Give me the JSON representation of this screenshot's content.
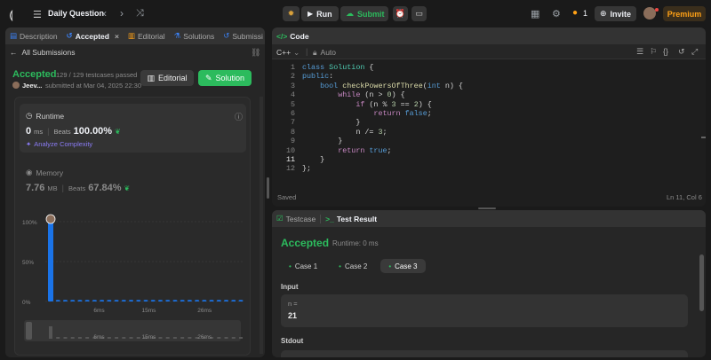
{
  "topbar": {
    "title": "Daily Question",
    "run": "Run",
    "submit": "Submit",
    "invite": "Invite",
    "premium": "Premium",
    "streak": "1"
  },
  "left": {
    "tabs": [
      {
        "label": "Description"
      },
      {
        "label": "Accepted"
      },
      {
        "label": "Editorial"
      },
      {
        "label": "Solutions"
      },
      {
        "label": "Submissi"
      }
    ],
    "back": "All Submissions",
    "status": "Accepted",
    "testcases": "129 / 129 testcases passed",
    "user": "Jeev...",
    "submitted": "submitted at Mar 04, 2025 22:30",
    "editorial_btn": "Editorial",
    "solution_btn": "Solution",
    "runtime": {
      "label": "Runtime",
      "value": "0",
      "unit": "ms",
      "beats_label": "Beats",
      "beats": "100.00%",
      "analyze": "Analyze Complexity"
    },
    "memory": {
      "label": "Memory",
      "value": "7.76",
      "unit": "MB",
      "beats_label": "Beats",
      "beats": "67.84%"
    }
  },
  "chart_data": {
    "type": "bar",
    "y_ticks": [
      "100%",
      "50%",
      "0%"
    ],
    "x_ticks": [
      "6ms",
      "15ms",
      "26ms"
    ],
    "ylim": [
      0,
      100
    ],
    "values": [
      100,
      2,
      2,
      2,
      2,
      2,
      2,
      2,
      2,
      2,
      2,
      2,
      2,
      2,
      2,
      2,
      2,
      2,
      2,
      2,
      2,
      2,
      2,
      2,
      2,
      2,
      2
    ],
    "mini_ticks": [
      "6ms",
      "15ms",
      "26ms"
    ]
  },
  "code": {
    "header": "Code",
    "lang": "C++",
    "mode": "Auto",
    "saved": "Saved",
    "cursor": "Ln 11, Col 6"
  },
  "bottom": {
    "tab_testcase": "Testcase",
    "tab_result": "Test Result",
    "status": "Accepted",
    "runtime": "Runtime: 0 ms",
    "cases": [
      {
        "label": "Case 1"
      },
      {
        "label": "Case 2"
      },
      {
        "label": "Case 3"
      }
    ],
    "input_label": "Input",
    "var": "n =",
    "val": "21",
    "stdout": "Stdout"
  },
  "colors": {
    "accent_green": "#2cbb5d",
    "bar_blue": "#1a73e8",
    "premium": "#ffa116"
  }
}
